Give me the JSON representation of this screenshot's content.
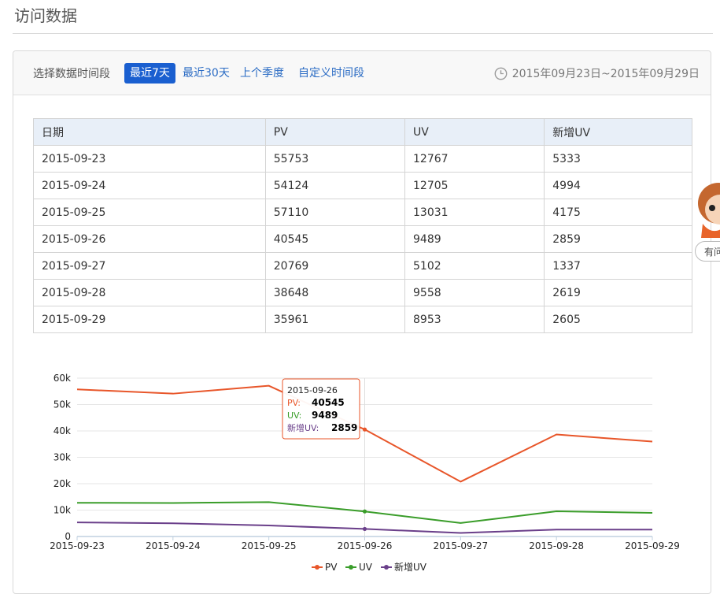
{
  "page": {
    "title": "访问数据"
  },
  "toolbar": {
    "range_label": "选择数据时间段",
    "ranges": [
      {
        "label": "最近7天",
        "active": true
      },
      {
        "label": "最近30天",
        "active": false
      },
      {
        "label": "上个季度",
        "active": false
      },
      {
        "label": "自定义时间段",
        "active": false
      }
    ],
    "date_range": "2015年09月23日~2015年09月29日"
  },
  "table": {
    "headers": [
      "日期",
      "PV",
      "UV",
      "新增UV"
    ],
    "rows": [
      [
        "2015-09-23",
        "55753",
        "12767",
        "5333"
      ],
      [
        "2015-09-24",
        "54124",
        "12705",
        "4994"
      ],
      [
        "2015-09-25",
        "57110",
        "13031",
        "4175"
      ],
      [
        "2015-09-26",
        "40545",
        "9489",
        "2859"
      ],
      [
        "2015-09-27",
        "20769",
        "5102",
        "1337"
      ],
      [
        "2015-09-28",
        "38648",
        "9558",
        "2619"
      ],
      [
        "2015-09-29",
        "35961",
        "8953",
        "2605"
      ]
    ]
  },
  "side": {
    "help_label": "有问"
  },
  "colors": {
    "accent": "#1a5fd0",
    "pv": "#e8562a",
    "uv": "#3a9d2a",
    "newuv": "#6a3f8a"
  },
  "chart_data": {
    "type": "line",
    "title": "",
    "xlabel": "",
    "ylabel": "",
    "categories": [
      "2015-09-23",
      "2015-09-24",
      "2015-09-25",
      "2015-09-26",
      "2015-09-27",
      "2015-09-28",
      "2015-09-29"
    ],
    "series": [
      {
        "name": "PV",
        "color": "#e8562a",
        "values": [
          55753,
          54124,
          57110,
          40545,
          20769,
          38648,
          35961
        ]
      },
      {
        "name": "UV",
        "color": "#3a9d2a",
        "values": [
          12767,
          12705,
          13031,
          9489,
          5102,
          9558,
          8953
        ]
      },
      {
        "name": "新增UV",
        "color": "#6a3f8a",
        "values": [
          5333,
          4994,
          4175,
          2859,
          1337,
          2619,
          2605
        ]
      }
    ],
    "ylim": [
      0,
      60000
    ],
    "yticks": [
      "0",
      "10k",
      "20k",
      "30k",
      "40k",
      "50k",
      "60k"
    ],
    "grid": true,
    "legend": "bottom-center",
    "tooltip": {
      "category": "2015-09-26",
      "lines": [
        {
          "label": "PV:",
          "value": "40545"
        },
        {
          "label": "UV:",
          "value": "9489"
        },
        {
          "label": "新增UV:",
          "value": "2859"
        }
      ]
    }
  }
}
